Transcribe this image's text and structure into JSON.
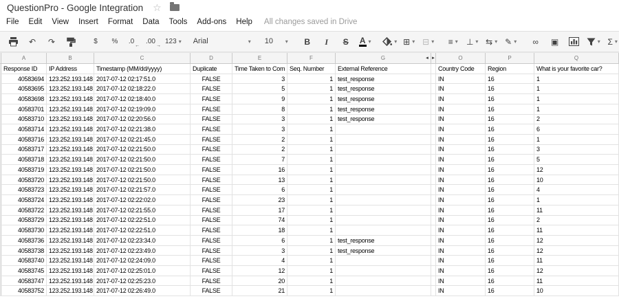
{
  "app": {
    "title": "QuestionPro - Google Integration",
    "saved_status": "All changes saved in Drive",
    "icons": {
      "star": "☆"
    },
    "menus": [
      "File",
      "Edit",
      "View",
      "Insert",
      "Format",
      "Data",
      "Tools",
      "Add-ons",
      "Help"
    ],
    "toolbar": {
      "groups": [
        {
          "items": [
            {
              "name": "print",
              "icon": "print"
            },
            {
              "name": "undo",
              "glyph": "↶"
            },
            {
              "name": "redo",
              "glyph": "↷"
            },
            {
              "name": "paint-format",
              "icon": "roller"
            }
          ]
        },
        {
          "items": [
            {
              "name": "format-currency",
              "glyph": "$",
              "small": true
            },
            {
              "name": "format-percent",
              "glyph": "%",
              "small": true
            },
            {
              "name": "decrease-decimals",
              "glyph": ".0",
              "small": true,
              "sub": "←"
            },
            {
              "name": "increase-decimals",
              "glyph": ".00",
              "small": true,
              "sub": "→"
            },
            {
              "name": "more-formats",
              "glyph": "123",
              "small": true,
              "caret": true
            }
          ]
        },
        {
          "items": [
            {
              "name": "font-family",
              "glyph": "Arial",
              "caret": true,
              "wide": true
            }
          ]
        },
        {
          "items": [
            {
              "name": "font-size",
              "glyph": "10",
              "caret": true,
              "medium": true
            }
          ]
        },
        {
          "items": [
            {
              "name": "bold",
              "glyph": "B",
              "cls": "b-bold"
            },
            {
              "name": "italic",
              "glyph": "I",
              "cls": "b-italic"
            },
            {
              "name": "strikethrough",
              "glyph": "S",
              "cls": "b-strike"
            },
            {
              "name": "text-color",
              "glyph": "A",
              "cls": "b-underbar",
              "caret": true
            }
          ]
        },
        {
          "items": [
            {
              "name": "fill-color",
              "icon": "bucket",
              "caret": true
            },
            {
              "name": "borders",
              "glyph": "⊞",
              "caret": true
            },
            {
              "name": "merge-cells",
              "glyph": "⊟",
              "caret": true,
              "disabled": true
            }
          ]
        },
        {
          "items": [
            {
              "name": "horizontal-align",
              "glyph": "≡",
              "caret": true
            },
            {
              "name": "vertical-align",
              "glyph": "⊥",
              "caret": true
            },
            {
              "name": "text-wrapping",
              "glyph": "⇆",
              "caret": true
            },
            {
              "name": "text-rotation",
              "glyph": "✎",
              "caret": true
            }
          ]
        },
        {
          "items": [
            {
              "name": "insert-link",
              "glyph": "∞"
            },
            {
              "name": "insert-comment",
              "glyph": "▣"
            },
            {
              "name": "insert-chart",
              "icon": "chart"
            },
            {
              "name": "filter",
              "icon": "funnel",
              "caret": true
            },
            {
              "name": "functions",
              "glyph": "Σ",
              "caret": true
            }
          ]
        }
      ]
    }
  },
  "sheet": {
    "column_letters": [
      "A",
      "B",
      "C",
      "D",
      "E",
      "F",
      "G",
      "O",
      "P",
      "Q"
    ],
    "hidden_columns_collapse_left": "◄",
    "hidden_columns_collapse_right": "►",
    "header_row": [
      "Response ID",
      "IP Address",
      "Timestamp (MM/dd/yyyy)",
      "Duplicate",
      "Time Taken to Com",
      "Seq. Number",
      "External Reference",
      "Country Code",
      "Region",
      "What is your favorite car?"
    ],
    "rows": [
      [
        "40583694",
        "123.252.193.148",
        "2017-07-12 02:17:51.0",
        "FALSE",
        "3",
        "1",
        "test_response",
        "IN",
        "16",
        "1"
      ],
      [
        "40583695",
        "123.252.193.148",
        "2017-07-12 02:18:22.0",
        "FALSE",
        "5",
        "1",
        "test_response",
        "IN",
        "16",
        "1"
      ],
      [
        "40583698",
        "123.252.193.148",
        "2017-07-12 02:18:40.0",
        "FALSE",
        "9",
        "1",
        "test_response",
        "IN",
        "16",
        "1"
      ],
      [
        "40583701",
        "123.252.193.148",
        "2017-07-12 02:19:09.0",
        "FALSE",
        "8",
        "1",
        "test_response",
        "IN",
        "16",
        "1"
      ],
      [
        "40583710",
        "123.252.193.148",
        "2017-07-12 02:20:56.0",
        "FALSE",
        "3",
        "1",
        "test_response",
        "IN",
        "16",
        "2"
      ],
      [
        "40583714",
        "123.252.193.148",
        "2017-07-12 02:21:38.0",
        "FALSE",
        "3",
        "1",
        "",
        "IN",
        "16",
        "6"
      ],
      [
        "40583716",
        "123.252.193.148",
        "2017-07-12 02:21:45.0",
        "FALSE",
        "2",
        "1",
        "",
        "IN",
        "16",
        "1"
      ],
      [
        "40583717",
        "123.252.193.148",
        "2017-07-12 02:21:50.0",
        "FALSE",
        "2",
        "1",
        "",
        "IN",
        "16",
        "3"
      ],
      [
        "40583718",
        "123.252.193.148",
        "2017-07-12 02:21:50.0",
        "FALSE",
        "7",
        "1",
        "",
        "IN",
        "16",
        "5"
      ],
      [
        "40583719",
        "123.252.193.148",
        "2017-07-12 02:21:50.0",
        "FALSE",
        "16",
        "1",
        "",
        "IN",
        "16",
        "12"
      ],
      [
        "40583720",
        "123.252.193.148",
        "2017-07-12 02:21:50.0",
        "FALSE",
        "13",
        "1",
        "",
        "IN",
        "16",
        "10"
      ],
      [
        "40583723",
        "123.252.193.148",
        "2017-07-12 02:21:57.0",
        "FALSE",
        "6",
        "1",
        "",
        "IN",
        "16",
        "4"
      ],
      [
        "40583724",
        "123.252.193.148",
        "2017-07-12 02:22:02.0",
        "FALSE",
        "23",
        "1",
        "",
        "IN",
        "16",
        "1"
      ],
      [
        "40583722",
        "123.252.193.148",
        "2017-07-12 02:21:55.0",
        "FALSE",
        "17",
        "1",
        "",
        "IN",
        "16",
        "11"
      ],
      [
        "40583729",
        "123.252.193.148",
        "2017-07-12 02:22:51.0",
        "FALSE",
        "74",
        "1",
        "",
        "IN",
        "16",
        "2"
      ],
      [
        "40583730",
        "123.252.193.148",
        "2017-07-12 02:22:51.0",
        "FALSE",
        "18",
        "1",
        "",
        "IN",
        "16",
        "11"
      ],
      [
        "40583736",
        "123.252.193.148",
        "2017-07-12 02:23:34.0",
        "FALSE",
        "6",
        "1",
        "test_response",
        "IN",
        "16",
        "12"
      ],
      [
        "40583738",
        "123.252.193.148",
        "2017-07-12 02:23:49.0",
        "FALSE",
        "3",
        "1",
        "test_response",
        "IN",
        "16",
        "12"
      ],
      [
        "40583740",
        "123.252.193.148",
        "2017-07-12 02:24:09.0",
        "FALSE",
        "4",
        "1",
        "",
        "IN",
        "16",
        "11"
      ],
      [
        "40583745",
        "123.252.193.148",
        "2017-07-12 02:25:01.0",
        "FALSE",
        "12",
        "1",
        "",
        "IN",
        "16",
        "12"
      ],
      [
        "40583747",
        "123.252.193.148",
        "2017-07-12 02:25:23.0",
        "FALSE",
        "20",
        "1",
        "",
        "IN",
        "16",
        "11"
      ],
      [
        "40583752",
        "123.252.193.148",
        "2017-07-12 02:26:49.0",
        "FALSE",
        "21",
        "1",
        "",
        "IN",
        "16",
        "10"
      ]
    ]
  }
}
